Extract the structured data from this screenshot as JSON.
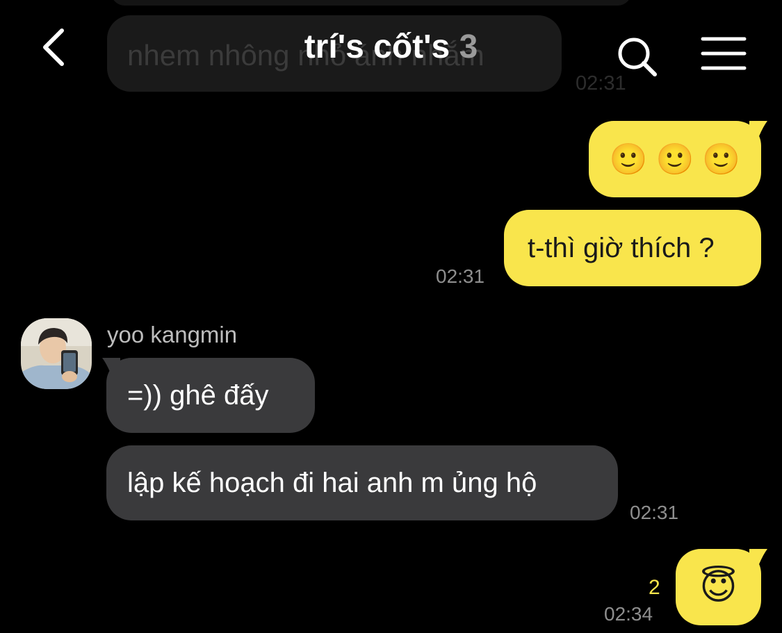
{
  "header": {
    "title": "trí's cốt's",
    "member_count": "3",
    "back_icon": "chevron-left-icon",
    "search_icon": "search-icon",
    "menu_icon": "hamburger-menu-icon"
  },
  "ghost_message": {
    "text": "nhem nhông   nhỏ ánh nhắm",
    "time": "02:31"
  },
  "messages": [
    {
      "side": "mine",
      "kind": "emoji",
      "emoji_name": "slightly-smiling-face-icon",
      "emojis": [
        "🙂",
        "🙂",
        "🙂"
      ]
    },
    {
      "side": "mine",
      "text": "t-thì giờ thích ?",
      "time": "02:31"
    },
    {
      "side": "theirs",
      "sender": "yoo kangmin",
      "text": "=)) ghê đấy"
    },
    {
      "side": "theirs",
      "text": "lập kế hoạch đi hai anh m ủng hộ",
      "time": "02:31"
    },
    {
      "side": "mine",
      "kind": "emoji",
      "emoji_name": "halo-smiling-face-icon",
      "emojis": [
        "😇"
      ],
      "unread": "2",
      "time": "02:34"
    }
  ],
  "colors": {
    "background": "#000000",
    "my_bubble": "#f9e54c",
    "their_bubble": "#3a3a3c",
    "timestamp": "#8e8e8e",
    "unread_count": "#f9e54c"
  }
}
